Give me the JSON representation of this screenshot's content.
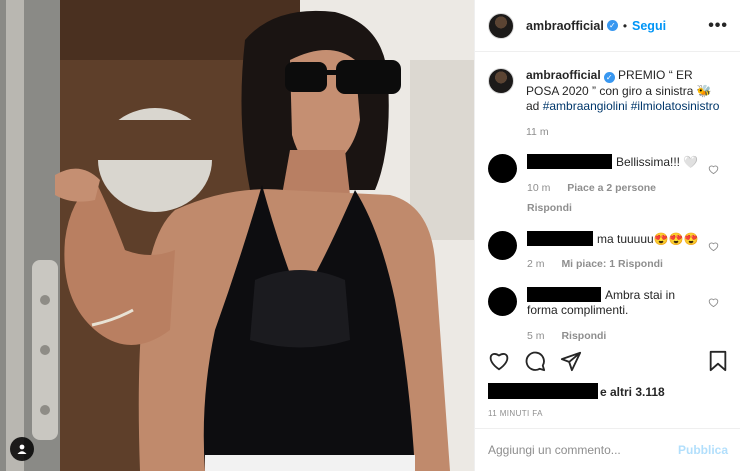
{
  "header": {
    "username": "ambraofficial",
    "verified_icon": "verified-badge-icon",
    "separator": "•",
    "follow_label": "Segui",
    "more_icon": "more-options-icon",
    "more_label": "•••"
  },
  "caption": {
    "username": "ambraofficial",
    "text": "PREMIO “ ER POSA 2020 ” con giro a sinistra 🐝 ad",
    "hashtags": "#ambraangiolini #ilmiolatosinistro",
    "time": "11 m"
  },
  "comments": [
    {
      "text": "Bellissima!!! 🤍",
      "time": "10 m",
      "likes": "Piace a 2 persone",
      "reply": "Rispondi"
    },
    {
      "text": "ma tuuuuu😍😍😍",
      "time": "2 m",
      "likes": "Mi piace: 1",
      "reply": "Rispondi"
    },
    {
      "text": "Ambra stai in forma complimenti.",
      "time": "5 m",
      "likes": "",
      "reply": "Rispondi"
    }
  ],
  "actions": {
    "like_icon": "heart-icon",
    "comment_icon": "comment-icon",
    "share_icon": "share-icon",
    "save_icon": "bookmark-icon"
  },
  "likes_summary": "e altri 3.118",
  "post_time": "11 MINUTI FA",
  "add_comment": {
    "placeholder": "Aggiungi un commento...",
    "publish_label": "Pubblica"
  },
  "colors": {
    "accent": "#0095f6",
    "hashtag": "#00376b",
    "muted": "#8e8e8e",
    "publish_disabled": "#b2dffc"
  }
}
